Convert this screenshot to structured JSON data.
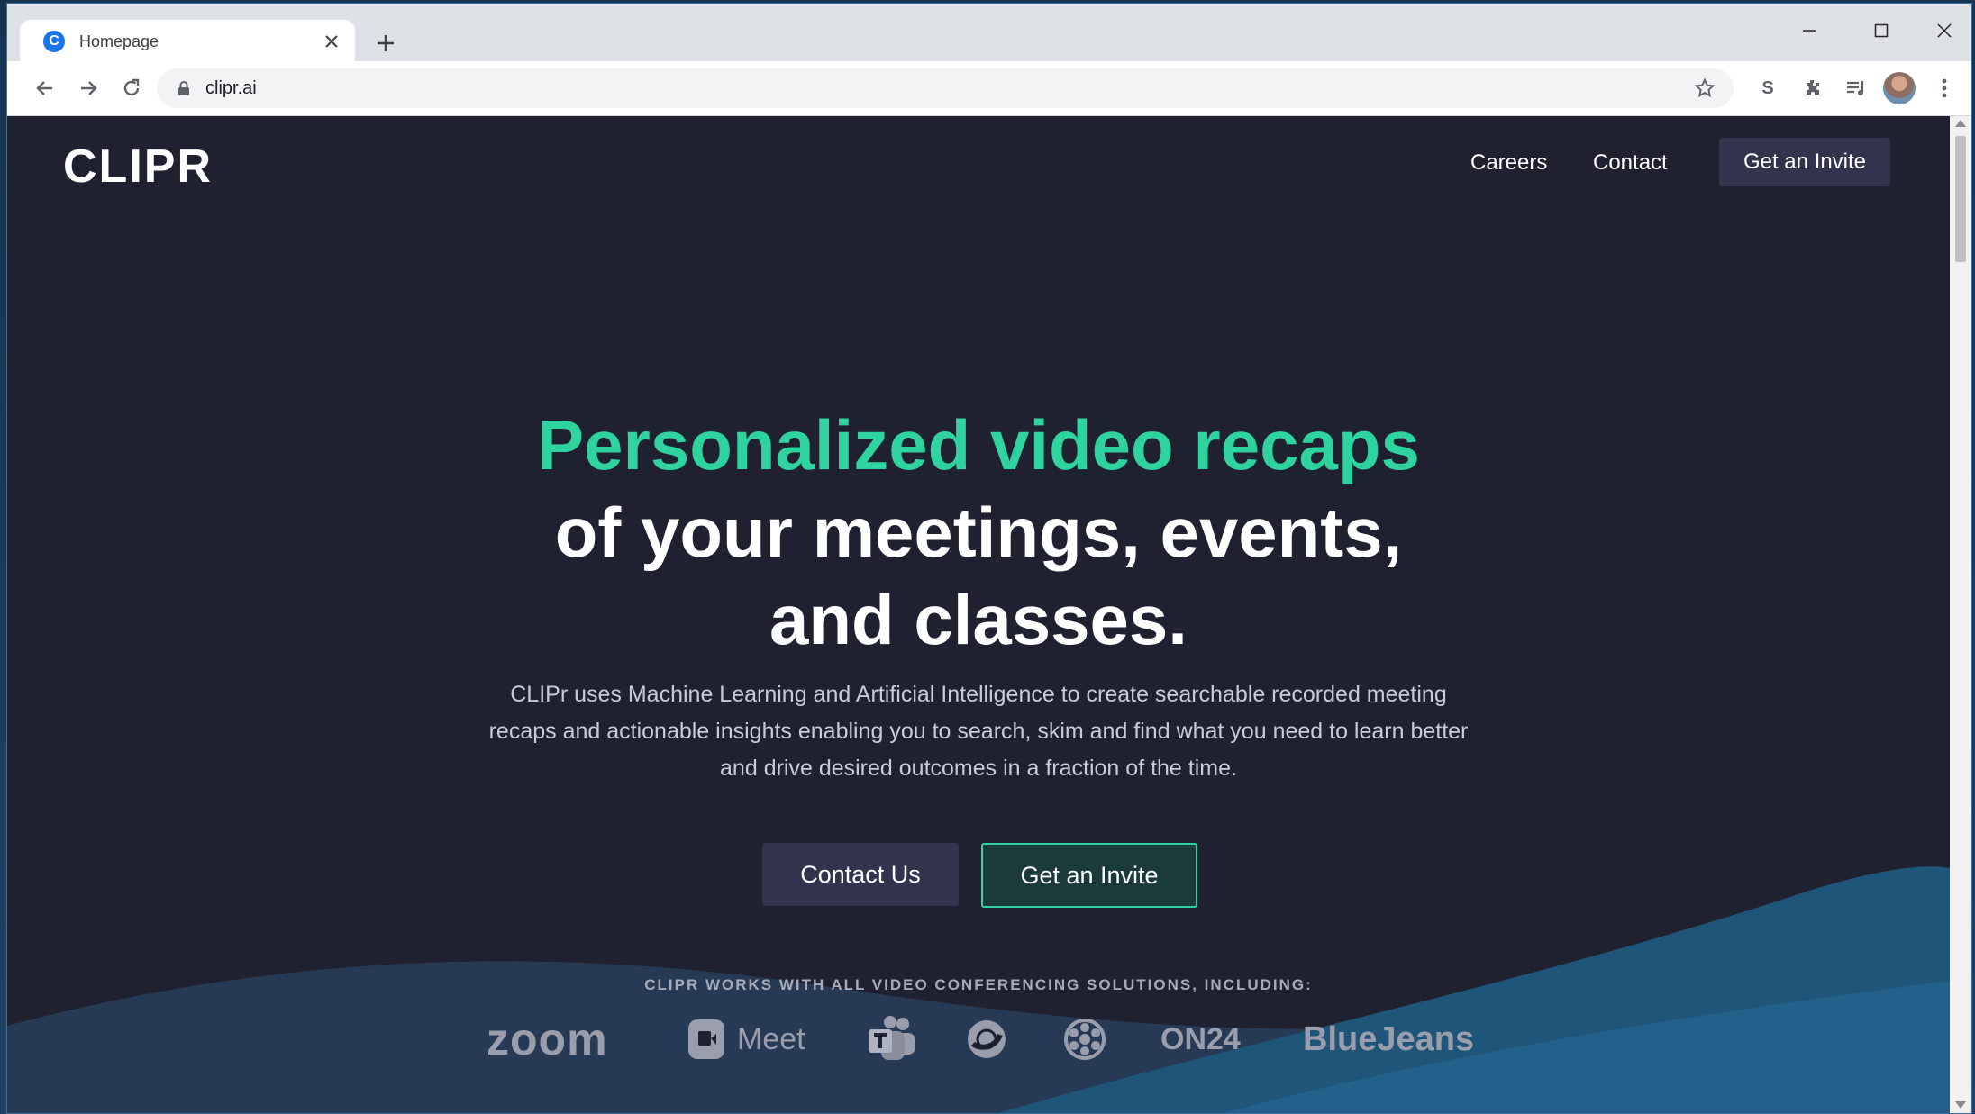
{
  "browser": {
    "tab_title": "Homepage",
    "favicon_letter": "C",
    "url": "clipr.ai",
    "extension_s_label": "S"
  },
  "site": {
    "logo": "CLIPR",
    "nav": {
      "careers": "Careers",
      "contact": "Contact",
      "invite": "Get an Invite"
    },
    "hero": {
      "accent": "Personalized video recaps",
      "line1": "of your meetings, events,",
      "line2": "and classes.",
      "description": "CLIPr uses Machine Learning and Artificial Intelligence to create searchable recorded meeting recaps and actionable insights enabling you to search, skim and find what you need to learn better and drive desired outcomes in a fraction of the time."
    },
    "buttons": {
      "contact_us": "Contact Us",
      "get_invite": "Get an Invite"
    },
    "works_with": "CLIPR WORKS WITH ALL VIDEO CONFERENCING SOLUTIONS, INCLUDING:",
    "partners": {
      "zoom": "zoom",
      "meet": "Meet",
      "on24": "ON24",
      "bluejeans": "BlueJeans"
    }
  },
  "colors": {
    "page_bg": "#1f2131",
    "accent_green": "#2ed3a0",
    "button_dark": "#32344e",
    "wave_blue": "#1e4f72"
  }
}
